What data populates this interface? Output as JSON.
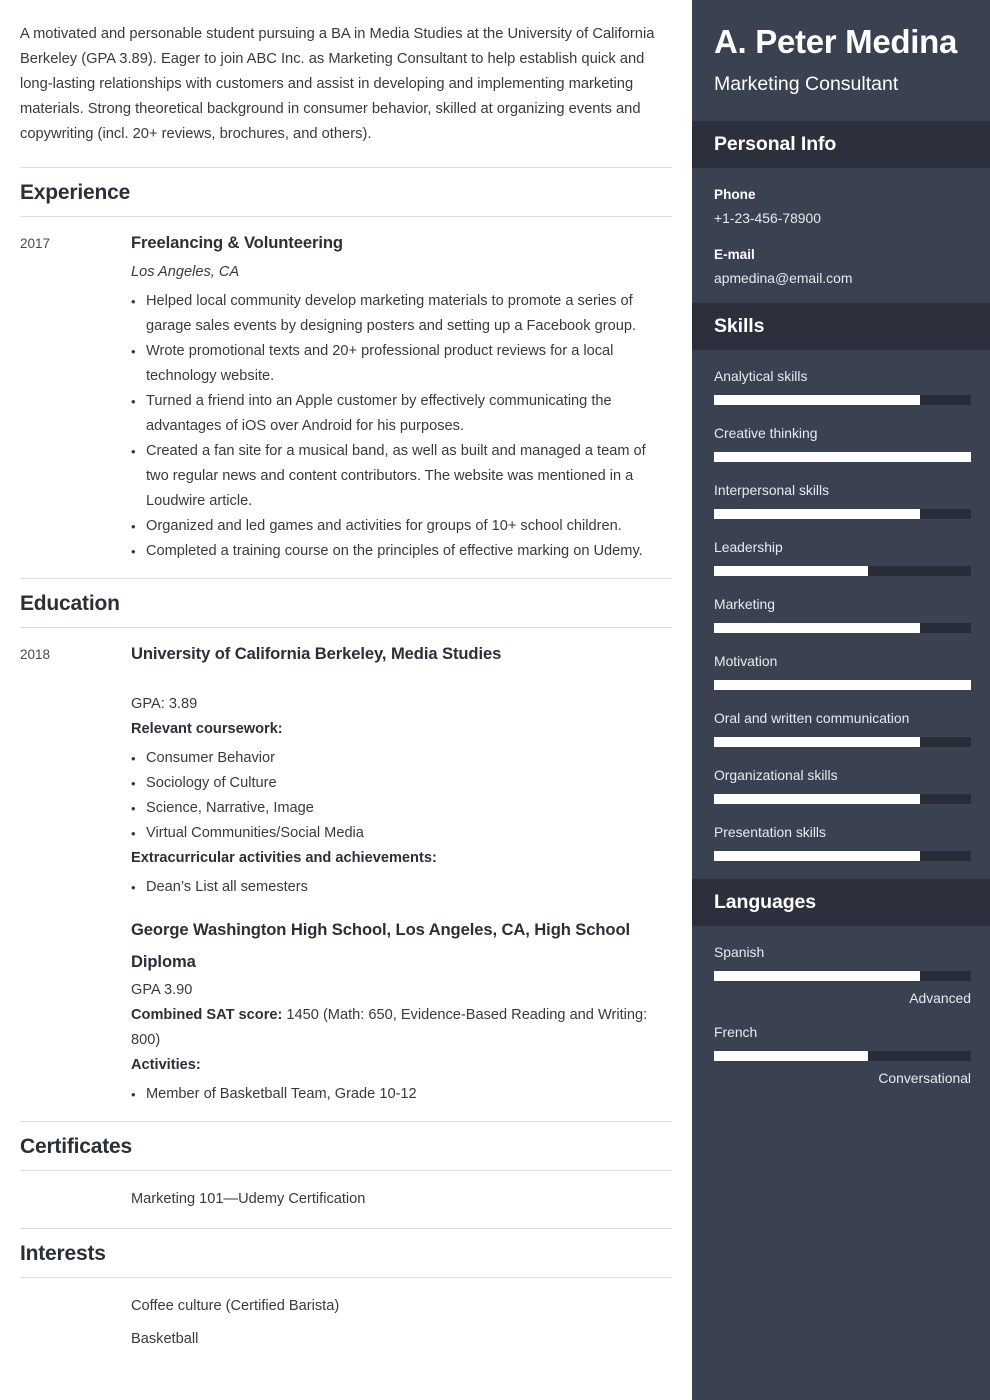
{
  "sidebar": {
    "name": "A. Peter Medina",
    "role": "Marketing Consultant",
    "personal_info": {
      "heading": "Personal Info",
      "fields": [
        {
          "label": "Phone",
          "value": "+1-23-456-78900"
        },
        {
          "label": "E-mail",
          "value": "apmedina@email.com"
        }
      ]
    },
    "skills": {
      "heading": "Skills",
      "items": [
        {
          "label": "Analytical skills",
          "level": 80
        },
        {
          "label": "Creative thinking",
          "level": 100
        },
        {
          "label": "Interpersonal skills",
          "level": 80
        },
        {
          "label": "Leadership",
          "level": 60
        },
        {
          "label": "Marketing",
          "level": 80
        },
        {
          "label": "Motivation",
          "level": 100
        },
        {
          "label": "Oral and written communication",
          "level": 80
        },
        {
          "label": "Organizational skills",
          "level": 80
        },
        {
          "label": "Presentation skills",
          "level": 80
        }
      ]
    },
    "languages": {
      "heading": "Languages",
      "items": [
        {
          "label": "Spanish",
          "level": 80,
          "proficiency": "Advanced"
        },
        {
          "label": "French",
          "level": 60,
          "proficiency": "Conversational"
        }
      ]
    },
    "colors": {
      "sidebar_bg": "#3a4150",
      "band_bg": "#2b303c",
      "bar_track": "#282d38",
      "bar_fill": "#ffffff"
    }
  },
  "main": {
    "summary": "A motivated and personable student pursuing a BA in Media Studies at the University of California Berkeley (GPA 3.89). Eager to join ABC Inc. as Marketing Consultant to help establish quick and long-lasting relationships with customers and assist in developing and implementing marketing materials. Strong theoretical background in consumer behavior, skilled at organizing events and copywriting (incl. 20+ reviews, brochures, and others).",
    "experience": {
      "heading": "Experience",
      "entries": [
        {
          "year": "2017",
          "title": "Freelancing & Volunteering",
          "location": "Los Angeles, CA",
          "bullets": [
            "Helped local community develop marketing materials to promote a series of garage sales events by designing posters and setting up a Facebook group.",
            "Wrote promotional texts and 20+ professional product reviews for a local technology website.",
            "Turned a friend into an Apple customer by effectively communicating the advantages of iOS over Android for his purposes.",
            "Created a fan site for a musical band, as well as built and managed a team of two regular news and content contributors. The website was mentioned in a Loudwire article.",
            "Organized and led games and activities for groups of 10+ school children.",
            "Completed a training course on the principles of effective marking on Udemy."
          ]
        }
      ]
    },
    "education": {
      "heading": "Education",
      "entries": [
        {
          "year": "2018",
          "title": "University of California Berkeley, Media Studies",
          "gpa": "GPA: 3.89",
          "coursework_label": "Relevant coursework:",
          "coursework": [
            "Consumer Behavior",
            "Sociology of Culture",
            "Science, Narrative, Image",
            "Virtual Communities/Social Media"
          ],
          "extracurricular_label": "Extracurricular activities and achievements:",
          "extracurricular": [
            "Dean’s List all semesters"
          ]
        },
        {
          "year": "",
          "title": "George Washington High School, Los Angeles, CA, High School Diploma",
          "gpa": "GPA 3.90",
          "sat_label": "Combined SAT score:",
          "sat_value": " 1450 (Math: 650, Evidence-Based Reading and Writing: 800)",
          "activities_label": "Activities:",
          "activities": [
            "Member of Basketball Team, Grade 10-12"
          ]
        }
      ]
    },
    "certificates": {
      "heading": "Certificates",
      "items": [
        "Marketing 101—Udemy Certification"
      ]
    },
    "interests": {
      "heading": "Interests",
      "items": [
        "Coffee culture (Certified Barista)",
        "Basketball"
      ]
    }
  }
}
